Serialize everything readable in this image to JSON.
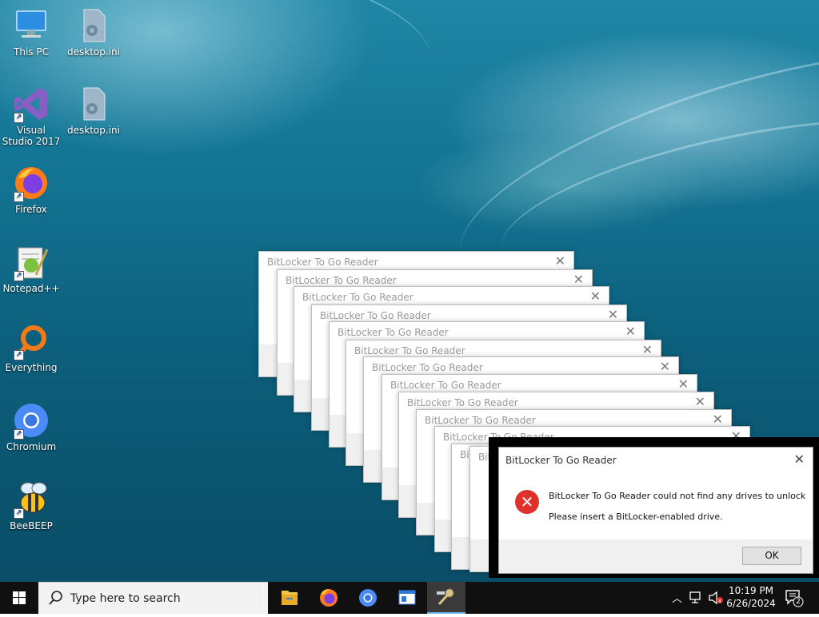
{
  "desktop": {
    "icons": [
      {
        "label": "This PC"
      },
      {
        "label": "desktop.ini"
      },
      {
        "label": "Visual Studio 2017"
      },
      {
        "label": "desktop.ini"
      },
      {
        "label": "Firefox"
      },
      {
        "label": "Notepad++"
      },
      {
        "label": "Everything"
      },
      {
        "label": "Chromium"
      },
      {
        "label": "BeeBEEP"
      }
    ]
  },
  "stacked_dialog_title": "BitLocker To Go Reader",
  "dialog": {
    "title": "BitLocker To Go Reader",
    "message1": "BitLocker To Go Reader could not find any drives to unlock",
    "message2": "Please insert a BitLocker-enabled drive.",
    "ok_label": "OK"
  },
  "taskbar": {
    "search_placeholder": "Type here to search",
    "time": "10:19 PM",
    "date": "6/26/2024",
    "notification_count": "2"
  },
  "colors": {
    "error_red": "#e0302b",
    "taskbar": "#101010",
    "start_blue": "#ffffff"
  }
}
